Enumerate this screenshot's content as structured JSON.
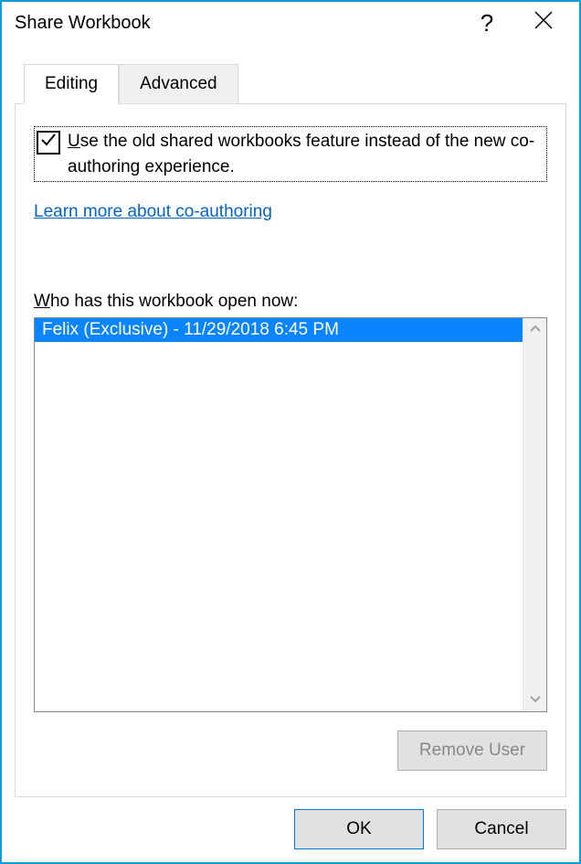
{
  "title": "Share Workbook",
  "tabs": {
    "editing": "Editing",
    "advanced": "Advanced"
  },
  "panel": {
    "use_old_prefix": "U",
    "use_old_rest": "se the old shared workbooks feature instead of the new co-authoring experience.",
    "learn_more": "Learn more about co-authoring",
    "who_prefix": "W",
    "who_rest": "ho has this workbook open now:",
    "users": [
      "Felix (Exclusive) - 11/29/2018 6:45 PM"
    ],
    "remove_user": "Remove User"
  },
  "buttons": {
    "ok": "OK",
    "cancel": "Cancel"
  }
}
